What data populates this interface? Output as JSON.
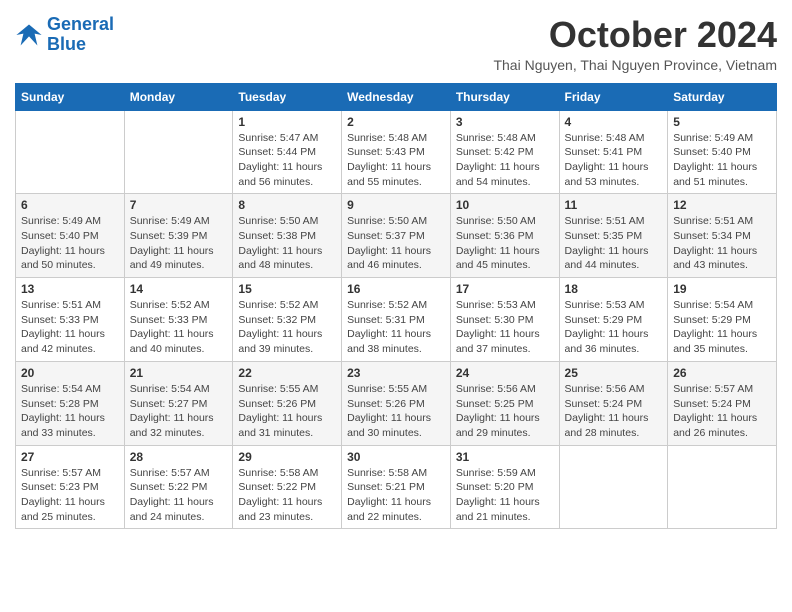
{
  "logo": {
    "line1": "General",
    "line2": "Blue"
  },
  "header": {
    "month": "October 2024",
    "location": "Thai Nguyen, Thai Nguyen Province, Vietnam"
  },
  "weekdays": [
    "Sunday",
    "Monday",
    "Tuesday",
    "Wednesday",
    "Thursday",
    "Friday",
    "Saturday"
  ],
  "weeks": [
    [
      {
        "day": "",
        "info": ""
      },
      {
        "day": "",
        "info": ""
      },
      {
        "day": "1",
        "info": "Sunrise: 5:47 AM\nSunset: 5:44 PM\nDaylight: 11 hours and 56 minutes."
      },
      {
        "day": "2",
        "info": "Sunrise: 5:48 AM\nSunset: 5:43 PM\nDaylight: 11 hours and 55 minutes."
      },
      {
        "day": "3",
        "info": "Sunrise: 5:48 AM\nSunset: 5:42 PM\nDaylight: 11 hours and 54 minutes."
      },
      {
        "day": "4",
        "info": "Sunrise: 5:48 AM\nSunset: 5:41 PM\nDaylight: 11 hours and 53 minutes."
      },
      {
        "day": "5",
        "info": "Sunrise: 5:49 AM\nSunset: 5:40 PM\nDaylight: 11 hours and 51 minutes."
      }
    ],
    [
      {
        "day": "6",
        "info": "Sunrise: 5:49 AM\nSunset: 5:40 PM\nDaylight: 11 hours and 50 minutes."
      },
      {
        "day": "7",
        "info": "Sunrise: 5:49 AM\nSunset: 5:39 PM\nDaylight: 11 hours and 49 minutes."
      },
      {
        "day": "8",
        "info": "Sunrise: 5:50 AM\nSunset: 5:38 PM\nDaylight: 11 hours and 48 minutes."
      },
      {
        "day": "9",
        "info": "Sunrise: 5:50 AM\nSunset: 5:37 PM\nDaylight: 11 hours and 46 minutes."
      },
      {
        "day": "10",
        "info": "Sunrise: 5:50 AM\nSunset: 5:36 PM\nDaylight: 11 hours and 45 minutes."
      },
      {
        "day": "11",
        "info": "Sunrise: 5:51 AM\nSunset: 5:35 PM\nDaylight: 11 hours and 44 minutes."
      },
      {
        "day": "12",
        "info": "Sunrise: 5:51 AM\nSunset: 5:34 PM\nDaylight: 11 hours and 43 minutes."
      }
    ],
    [
      {
        "day": "13",
        "info": "Sunrise: 5:51 AM\nSunset: 5:33 PM\nDaylight: 11 hours and 42 minutes."
      },
      {
        "day": "14",
        "info": "Sunrise: 5:52 AM\nSunset: 5:33 PM\nDaylight: 11 hours and 40 minutes."
      },
      {
        "day": "15",
        "info": "Sunrise: 5:52 AM\nSunset: 5:32 PM\nDaylight: 11 hours and 39 minutes."
      },
      {
        "day": "16",
        "info": "Sunrise: 5:52 AM\nSunset: 5:31 PM\nDaylight: 11 hours and 38 minutes."
      },
      {
        "day": "17",
        "info": "Sunrise: 5:53 AM\nSunset: 5:30 PM\nDaylight: 11 hours and 37 minutes."
      },
      {
        "day": "18",
        "info": "Sunrise: 5:53 AM\nSunset: 5:29 PM\nDaylight: 11 hours and 36 minutes."
      },
      {
        "day": "19",
        "info": "Sunrise: 5:54 AM\nSunset: 5:29 PM\nDaylight: 11 hours and 35 minutes."
      }
    ],
    [
      {
        "day": "20",
        "info": "Sunrise: 5:54 AM\nSunset: 5:28 PM\nDaylight: 11 hours and 33 minutes."
      },
      {
        "day": "21",
        "info": "Sunrise: 5:54 AM\nSunset: 5:27 PM\nDaylight: 11 hours and 32 minutes."
      },
      {
        "day": "22",
        "info": "Sunrise: 5:55 AM\nSunset: 5:26 PM\nDaylight: 11 hours and 31 minutes."
      },
      {
        "day": "23",
        "info": "Sunrise: 5:55 AM\nSunset: 5:26 PM\nDaylight: 11 hours and 30 minutes."
      },
      {
        "day": "24",
        "info": "Sunrise: 5:56 AM\nSunset: 5:25 PM\nDaylight: 11 hours and 29 minutes."
      },
      {
        "day": "25",
        "info": "Sunrise: 5:56 AM\nSunset: 5:24 PM\nDaylight: 11 hours and 28 minutes."
      },
      {
        "day": "26",
        "info": "Sunrise: 5:57 AM\nSunset: 5:24 PM\nDaylight: 11 hours and 26 minutes."
      }
    ],
    [
      {
        "day": "27",
        "info": "Sunrise: 5:57 AM\nSunset: 5:23 PM\nDaylight: 11 hours and 25 minutes."
      },
      {
        "day": "28",
        "info": "Sunrise: 5:57 AM\nSunset: 5:22 PM\nDaylight: 11 hours and 24 minutes."
      },
      {
        "day": "29",
        "info": "Sunrise: 5:58 AM\nSunset: 5:22 PM\nDaylight: 11 hours and 23 minutes."
      },
      {
        "day": "30",
        "info": "Sunrise: 5:58 AM\nSunset: 5:21 PM\nDaylight: 11 hours and 22 minutes."
      },
      {
        "day": "31",
        "info": "Sunrise: 5:59 AM\nSunset: 5:20 PM\nDaylight: 11 hours and 21 minutes."
      },
      {
        "day": "",
        "info": ""
      },
      {
        "day": "",
        "info": ""
      }
    ]
  ]
}
